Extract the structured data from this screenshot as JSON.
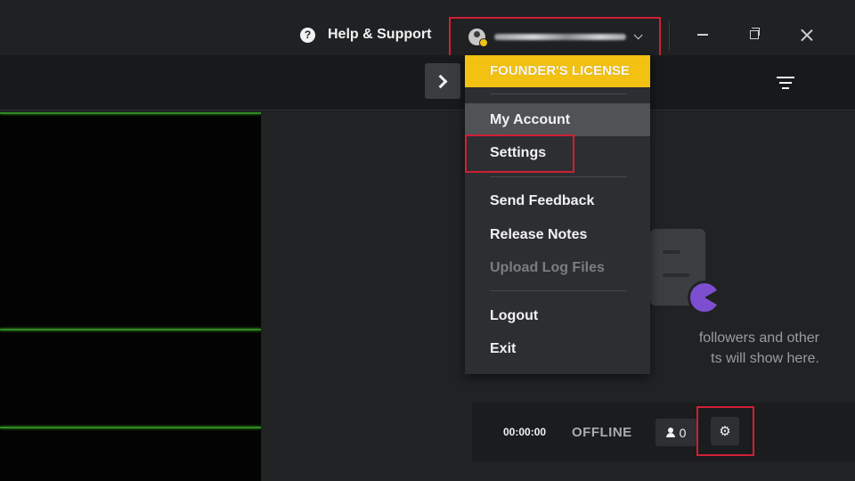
{
  "titlebar": {
    "help_label": "Help & Support",
    "help_icon": "?"
  },
  "toolbar": {},
  "menu": {
    "license": "FOUNDER'S LICENSE",
    "items": [
      {
        "label": "My Account"
      },
      {
        "label": "Settings"
      },
      {
        "label": "Send Feedback"
      },
      {
        "label": "Release Notes"
      },
      {
        "label": "Upload Log Files"
      },
      {
        "label": "Logout"
      },
      {
        "label": "Exit"
      }
    ]
  },
  "empty_state": {
    "line1": "followers and other",
    "line2": "ts will show here."
  },
  "status": {
    "timer": "00:00:00",
    "state": "OFFLINE",
    "viewers": "0",
    "gear_glyph": "⚙"
  },
  "colors": {
    "accent_yellow": "#f2c111",
    "highlight_red": "#d01f35",
    "preview_line_green": "#2e8a21",
    "illustration_purple": "#7d4fd0"
  },
  "icons": [
    "help-icon",
    "avatar-icon",
    "chevron-down-icon",
    "minimize-icon",
    "restore-icon",
    "close-icon",
    "chevron-right-icon",
    "filter-icon",
    "person-icon",
    "gear-icon"
  ]
}
